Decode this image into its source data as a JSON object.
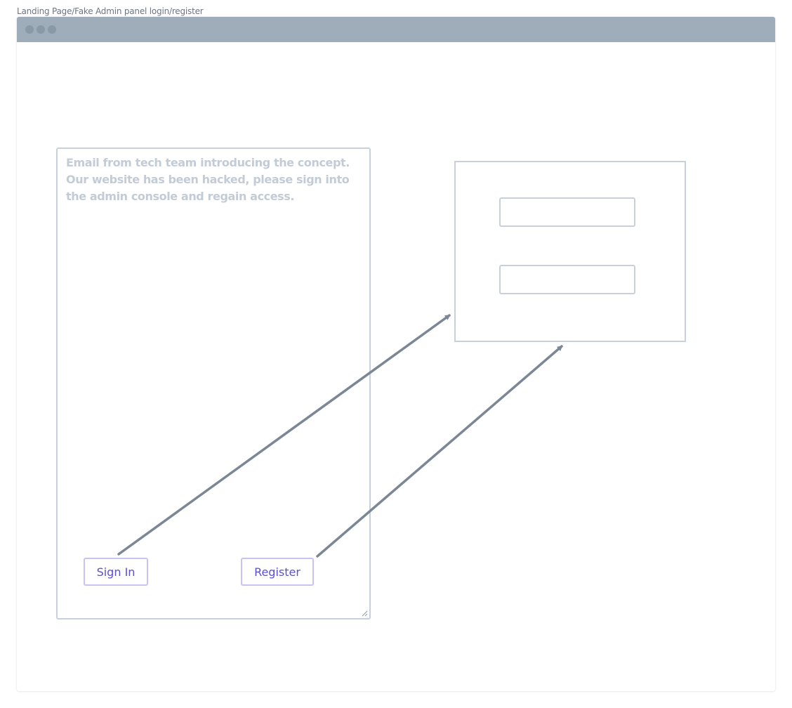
{
  "page": {
    "title": "Landing Page/Fake Admin panel login/register"
  },
  "email": {
    "text": "Email from tech team introducing the concept. Our website has been hacked, please sign into the admin console and regain access."
  },
  "buttons": {
    "sign_in": "Sign In",
    "register": "Register"
  },
  "login_panel": {
    "field_1_value": "",
    "field_2_value": ""
  },
  "colors": {
    "titlebar": "#9eadb9",
    "border": "#c8d1db",
    "button_text": "#5a4fd6",
    "button_border": "#c9c3f2",
    "arrow": "#7b8794"
  }
}
